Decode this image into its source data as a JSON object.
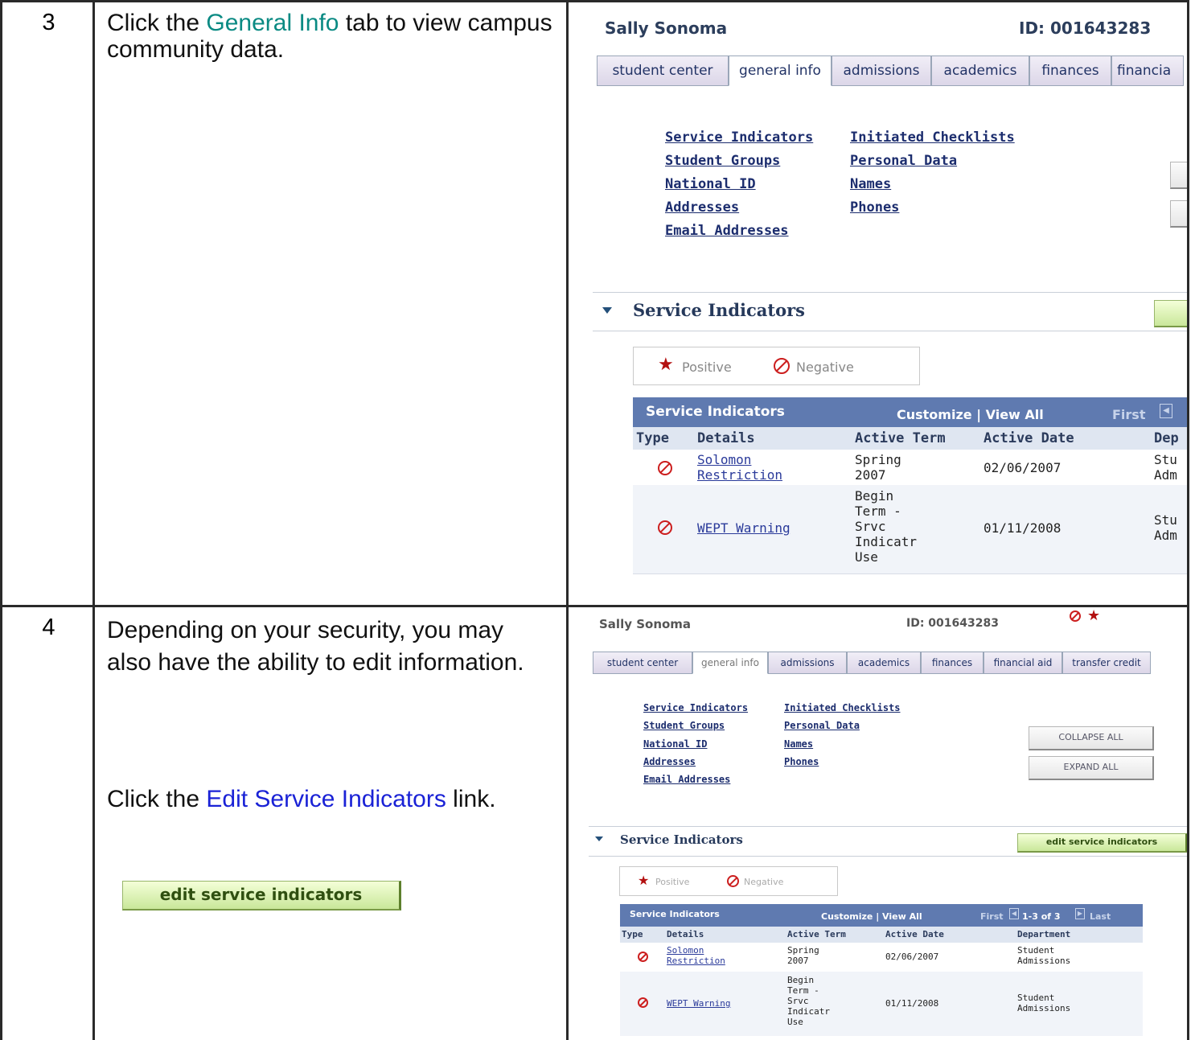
{
  "steps": [
    {
      "number": "3",
      "instruction_pre": "Click the ",
      "instruction_link": "General Info",
      "instruction_post": " tab to view campus community data."
    },
    {
      "number": "4",
      "instruction_1": "Depending on your security, you may also have the ability to edit information.",
      "instruction_2_pre": "Click the ",
      "instruction_2_link": "Edit Service Indicators",
      "instruction_2_post": " link.",
      "button_label": "edit service indicators"
    }
  ],
  "screen": {
    "student_name": "Sally Sonoma",
    "student_id": "ID:  001643283",
    "tabs_top": [
      "student center",
      "general info",
      "admissions",
      "academics",
      "finances",
      "financia"
    ],
    "tabs_bottom": [
      "student center",
      "general info",
      "admissions",
      "academics",
      "finances",
      "financial aid",
      "transfer credit"
    ],
    "links_col1": [
      "Service Indicators",
      "Student Groups",
      "National ID",
      "Addresses",
      "Email Addresses"
    ],
    "links_col2": [
      "Initiated Checklists",
      "Personal Data",
      "Names",
      "Phones"
    ],
    "collapse_all": "COLLAPSE ALL",
    "expand_all": "EXPAND ALL",
    "section_title": "Service Indicators",
    "edit_button": "edit service indicators",
    "legend_positive": "Positive",
    "legend_negative": "Negative",
    "grid_title": "Service Indicators",
    "grid_nav_top": "Customize | View All",
    "grid_first": "First",
    "grid_nav_bottom": "Customize | View All",
    "grid_count": "1-3 of 3",
    "grid_last": "Last",
    "columns_top": [
      "Type",
      "Details",
      "Active Term",
      "Active Date",
      "Dep"
    ],
    "columns_bottom": [
      "Type",
      "Details",
      "Active Term",
      "Active Date",
      "Department"
    ],
    "rows": [
      {
        "details": "Solomon\nRestriction",
        "term": "Spring\n2007",
        "date": "02/06/2007",
        "dept_top": "Stu\nAdm",
        "dept": "Student\nAdmissions"
      },
      {
        "details": "WEPT Warning",
        "term": "Begin\nTerm -\nSrvc\nIndicatr\nUse",
        "date": "01/11/2008",
        "dept_top": "Stu\nAdm",
        "dept": "Student\nAdmissions"
      }
    ]
  }
}
